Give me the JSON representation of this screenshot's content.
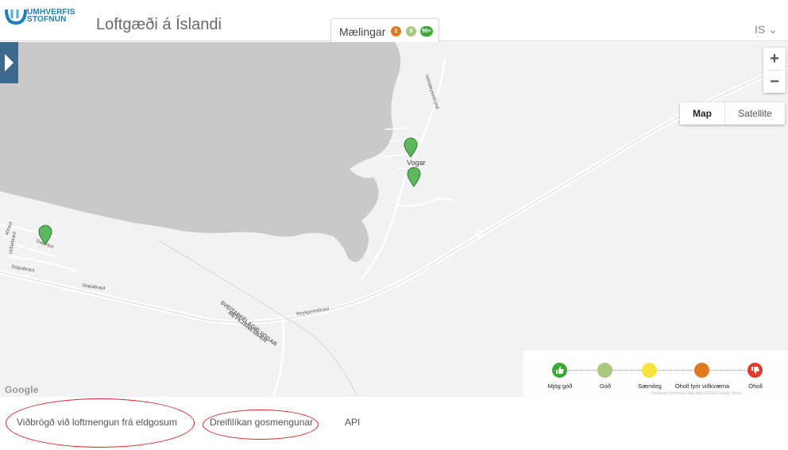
{
  "header": {
    "logo_line1": "UMHVERFIS",
    "logo_line2": "STOFNUN",
    "title": "Loftgæði á Íslandi",
    "measurements_label": "Mælingar",
    "badges": [
      {
        "text": "2",
        "color": "#e07a1f"
      },
      {
        "text": "8",
        "color": "#a9c77e"
      },
      {
        "text": "99+",
        "color": "#3aaa35"
      }
    ],
    "language": "IS ⌄"
  },
  "map": {
    "zoom_in": "+",
    "zoom_out": "−",
    "map_type": {
      "map": "Map",
      "satellite": "Satellite"
    },
    "places": {
      "vogar": "Vogar",
      "vatnsleysustrond": "Vatnsleysustrond",
      "dalbraut": "Dalbraut",
      "urdarbraut": "Urðarbraut",
      "stapabraut1": "Stapabraut",
      "stapabraut2": "Stapabraut",
      "reykjanesbraut": "Reykjanesbraut",
      "municipality": "SVEITARFÉLAGIÐ VOGAR",
      "reykjanesbaer": "REYKJANESBÆR",
      "abraut": "abraut"
    },
    "google": "Google",
    "fine_print": "Keyboard shortcuts   Map data ©2019 Google   Terms"
  },
  "legend": {
    "items": [
      {
        "label": "Mjög góð",
        "color": "#3aaa35",
        "icon": "thumbs-up-icon"
      },
      {
        "label": "Góð",
        "color": "#a9c77e",
        "icon": ""
      },
      {
        "label": "Sæmileg",
        "color": "#f4e53c",
        "icon": ""
      },
      {
        "label": "Óholl fyrir viðkvæma",
        "color": "#e07a1f",
        "icon": ""
      },
      {
        "label": "Óholl",
        "color": "#e23b2c",
        "icon": "thumbs-down-icon"
      }
    ]
  },
  "footer": {
    "links": [
      "Viðbrögð við loftmengun frá eldgosum",
      "Dreifilíkan gosmengunar",
      "API"
    ]
  },
  "colors": {
    "accent": "#3f6a8f",
    "brand": "#1f7fb8",
    "marker": "#5cb85c",
    "annotation": "#dd2222"
  }
}
